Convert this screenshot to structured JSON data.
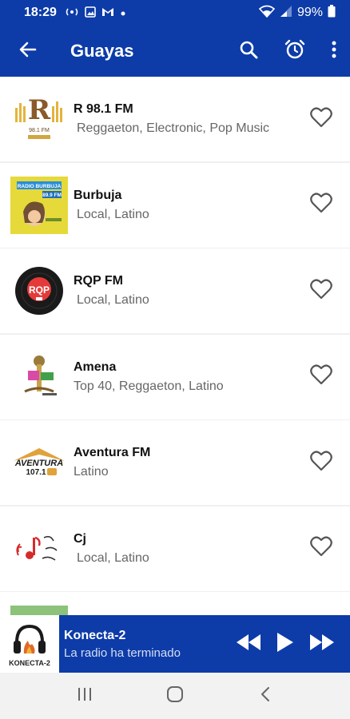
{
  "status_bar": {
    "time": "18:29",
    "notif_icons": [
      "radio-waves-icon",
      "image-icon",
      "gmail-icon",
      "dot-icon"
    ],
    "battery": "99%"
  },
  "appbar": {
    "title": "Guayas",
    "color": "#0d3ca8"
  },
  "stations": [
    {
      "name": "R 98.1 FM",
      "genres": "Reggaeton, Electronic, Pop Music",
      "logo_text": "R",
      "logo_sub": "98.1 FM"
    },
    {
      "name": "Burbuja",
      "genres": "Local, Latino",
      "logo_text": "RADIO BURBUJA",
      "logo_sub": "89.9 FM"
    },
    {
      "name": "RQP FM",
      "genres": "Local, Latino",
      "logo_text": "RQP"
    },
    {
      "name": "Amena",
      "genres": "Top 40, Reggaeton, Latino"
    },
    {
      "name": "Aventura FM",
      "genres": "Latino",
      "logo_text": "AVENTURA",
      "logo_sub": "107.1"
    },
    {
      "name": "Cj",
      "genres": "Local, Latino"
    }
  ],
  "player": {
    "station": "Konecta-2",
    "status": "La radio ha terminado",
    "logo_text": "KONECTA-2"
  }
}
